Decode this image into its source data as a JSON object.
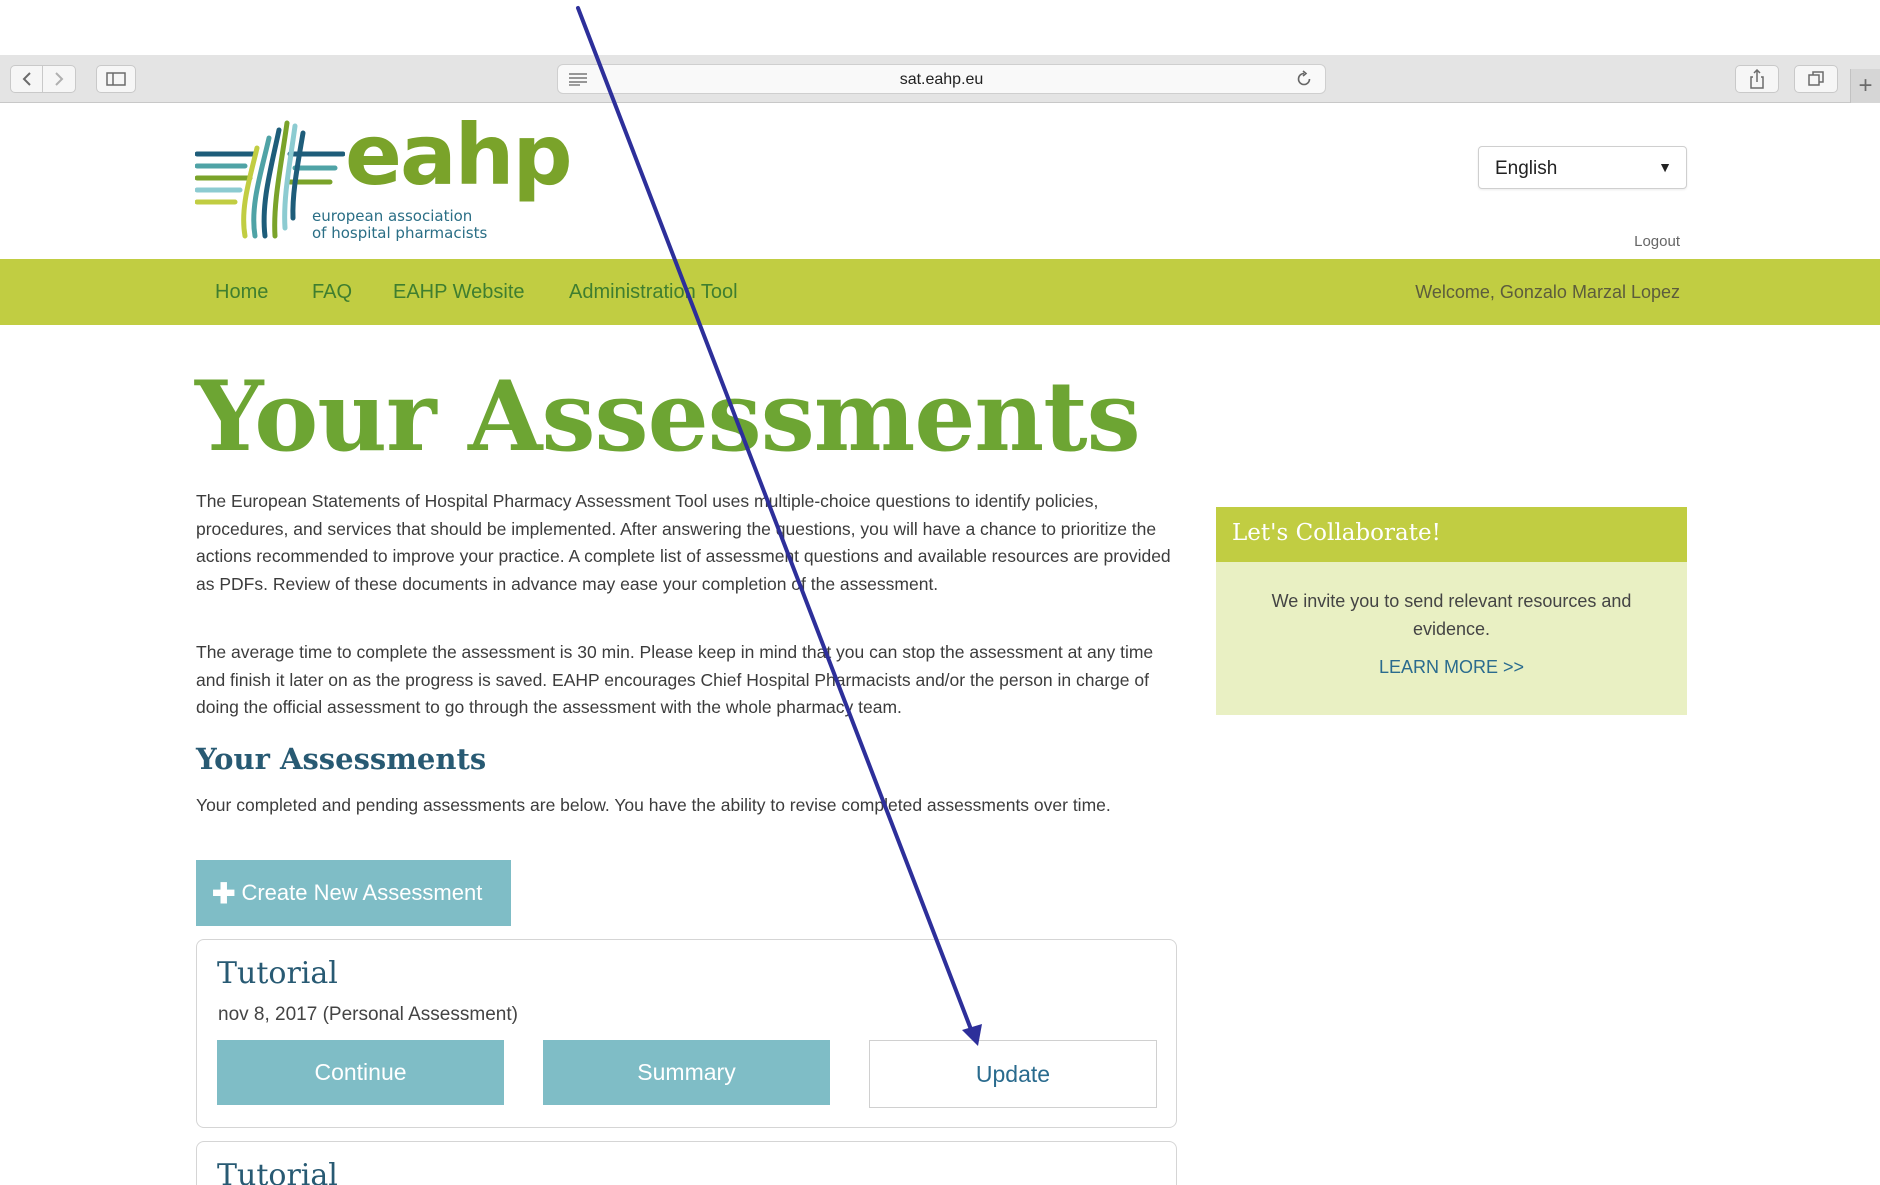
{
  "browser": {
    "url": "sat.eahp.eu"
  },
  "header": {
    "logo_word": "eahp",
    "logo_tagline_1": "european association",
    "logo_tagline_2": "of hospital pharmacists",
    "language": "English",
    "logout": "Logout"
  },
  "nav": {
    "items": [
      {
        "label": "Home"
      },
      {
        "label": "FAQ"
      },
      {
        "label": "EAHP Website"
      },
      {
        "label": "Administration Tool"
      }
    ],
    "welcome": "Welcome, Gonzalo Marzal Lopez"
  },
  "main": {
    "title": "Your Assessments",
    "paragraph_1": "The European Statements of Hospital Pharmacy Assessment Tool uses multiple-choice questions to identify policies, procedures, and services that should be implemented. After answering the questions, you will have a chance to prioritize the actions recommended to improve your practice. A complete list of assessment questions and available resources are provided as PDFs. Review of these documents in advance may ease your completion of the assessment.",
    "paragraph_2": "The average time to complete the assessment is 30 min. Please keep in mind that you can stop the assessment at any time and finish it later on as the progress is saved. EAHP encourages Chief Hospital Pharmacists and/or the person in charge of doing the official assessment to go through the assessment with the whole pharmacy team.",
    "subtitle": "Your Assessments",
    "paragraph_3": "Your completed and pending assessments are below. You have the ability to revise completed assessments over time.",
    "create_button": "Create New Assessment",
    "create_icon": "plus-icon"
  },
  "assessments": [
    {
      "title": "Tutorial",
      "date": "nov 8, 2017 (Personal Assessment)",
      "continue_label": "Continue",
      "summary_label": "Summary",
      "update_label": "Update"
    },
    {
      "title": "Tutorial"
    }
  ],
  "sidebar": {
    "title": "Let's Collaborate!",
    "text": "We invite you to send relevant resources and evidence.",
    "link": "LEARN MORE >>"
  },
  "colors": {
    "brand_green": "#c1cd42",
    "title_green": "#6da533",
    "teal_button": "#7fbdc6",
    "navy_heading": "#285a73",
    "annotation_arrow": "#2d2f9a"
  }
}
